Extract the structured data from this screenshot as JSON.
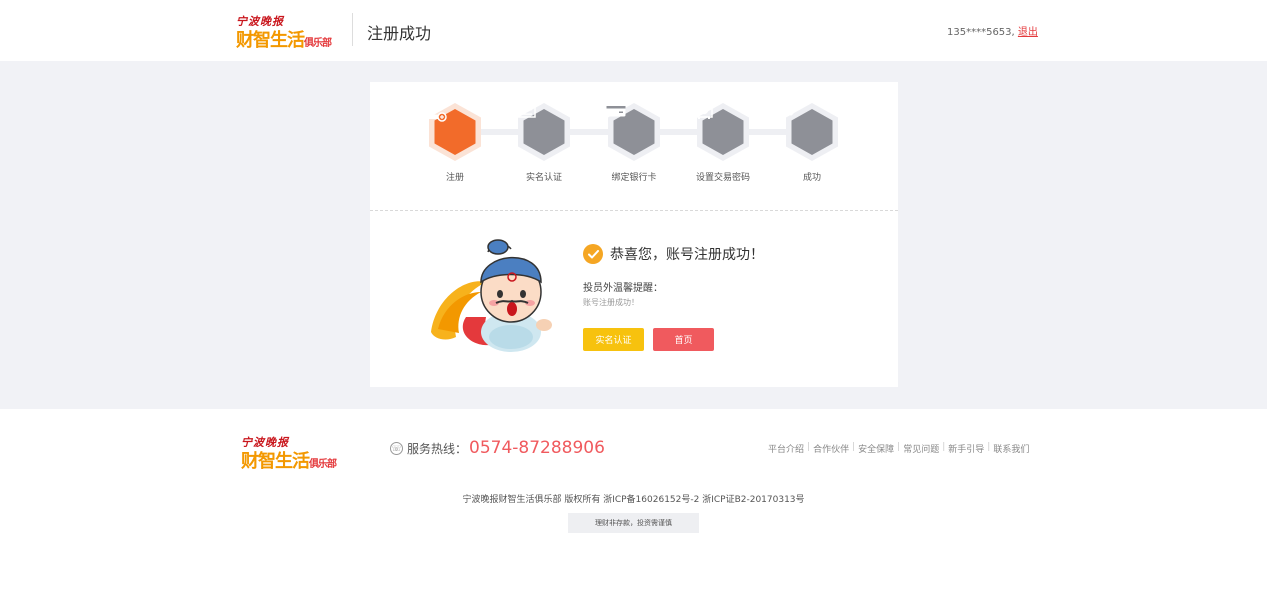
{
  "header": {
    "logo_line1": "宁波晚报",
    "logo_line2": "财智生活",
    "logo_line2_small": "俱乐部",
    "page_title": "注册成功",
    "user_phone": "135****5653,",
    "logout_label": "退出"
  },
  "steps": [
    {
      "label": "注册",
      "icon": "user-add-icon",
      "active": true
    },
    {
      "label": "实名认证",
      "icon": "id-card-icon",
      "active": false
    },
    {
      "label": "绑定银行卡",
      "icon": "bank-card-icon",
      "active": false
    },
    {
      "label": "设置交易密码",
      "icon": "safe-icon",
      "active": false
    },
    {
      "label": "成功",
      "icon": "check-icon",
      "active": false
    }
  ],
  "success": {
    "title": "恭喜您，账号注册成功！",
    "tip_title": "投员外温馨提醒：",
    "tip_text": "账号注册成功！",
    "btn_verify": "实名认证",
    "btn_home": "首页"
  },
  "footer": {
    "logo_line1": "宁波晚报",
    "logo_line2": "财智生活",
    "logo_line2_small": "俱乐部",
    "hotline_label": "服务热线：",
    "hotline_number": "0574-87288906",
    "links": [
      "平台介绍",
      "合作伙伴",
      "安全保障",
      "常见问题",
      "新手引导",
      "联系我们"
    ],
    "copyright": "宁波晚报财智生活俱乐部  版权所有 浙ICP备16026152号-2 浙ICP证B2-20170313号",
    "risk_notice": "理财非存款，投资需谨慎"
  },
  "colors": {
    "active_step": "#f26b2a",
    "inactive_step": "#8e9097",
    "verify_button": "#f7c20e",
    "home_button": "#f05a5e",
    "hotline": "#f05a5e"
  }
}
